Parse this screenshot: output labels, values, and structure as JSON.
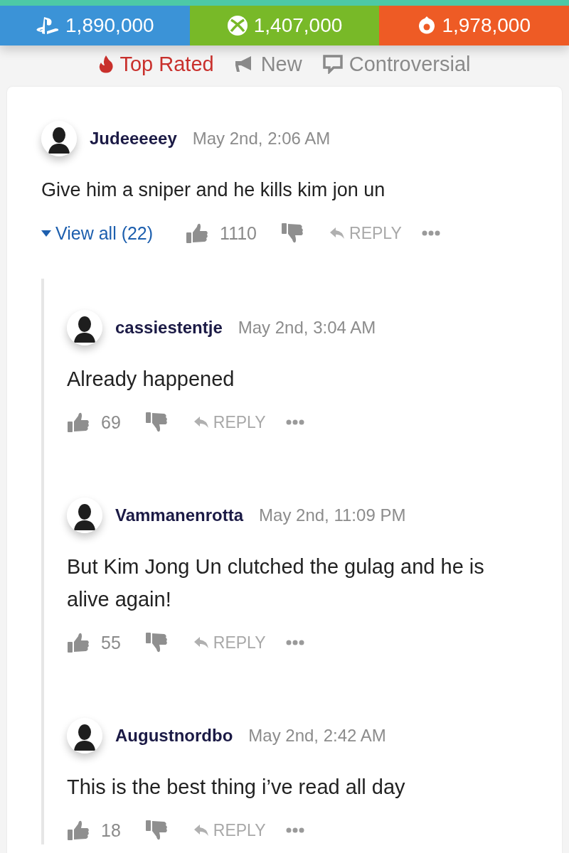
{
  "platforms": [
    {
      "kind": "playstation",
      "count": "1,890,000",
      "color": "#3b93d7"
    },
    {
      "kind": "xbox",
      "count": "1,407,000",
      "color": "#78b928"
    },
    {
      "kind": "origin",
      "count": "1,978,000",
      "color": "#ee5b25"
    }
  ],
  "sort_tabs": [
    {
      "label": "Top Rated",
      "selected": true
    },
    {
      "label": "New",
      "selected": false
    },
    {
      "label": "Controversial",
      "selected": false
    }
  ],
  "comment": {
    "user": "Judeeeeey",
    "date": "May 2nd, 2:06 AM",
    "text": "Give him a sniper and he kills kim jon un",
    "view_all": "View all (22)",
    "likes": "1110",
    "reply": "REPLY",
    "replies": [
      {
        "user": "cassiestentje",
        "date": "May 2nd, 3:04 AM",
        "text": "Already happened",
        "likes": "69",
        "reply": "REPLY"
      },
      {
        "user": "Vammanenrotta",
        "date": "May 2nd, 11:09 PM",
        "text": "But Kim Jong Un clutched the gulag and he is alive again!",
        "likes": "55",
        "reply": "REPLY"
      },
      {
        "user": "Augustnordbo",
        "date": "May 2nd, 2:42 AM",
        "text": "This is the best thing i’ve read all day",
        "likes": "18",
        "reply": "REPLY"
      }
    ]
  }
}
